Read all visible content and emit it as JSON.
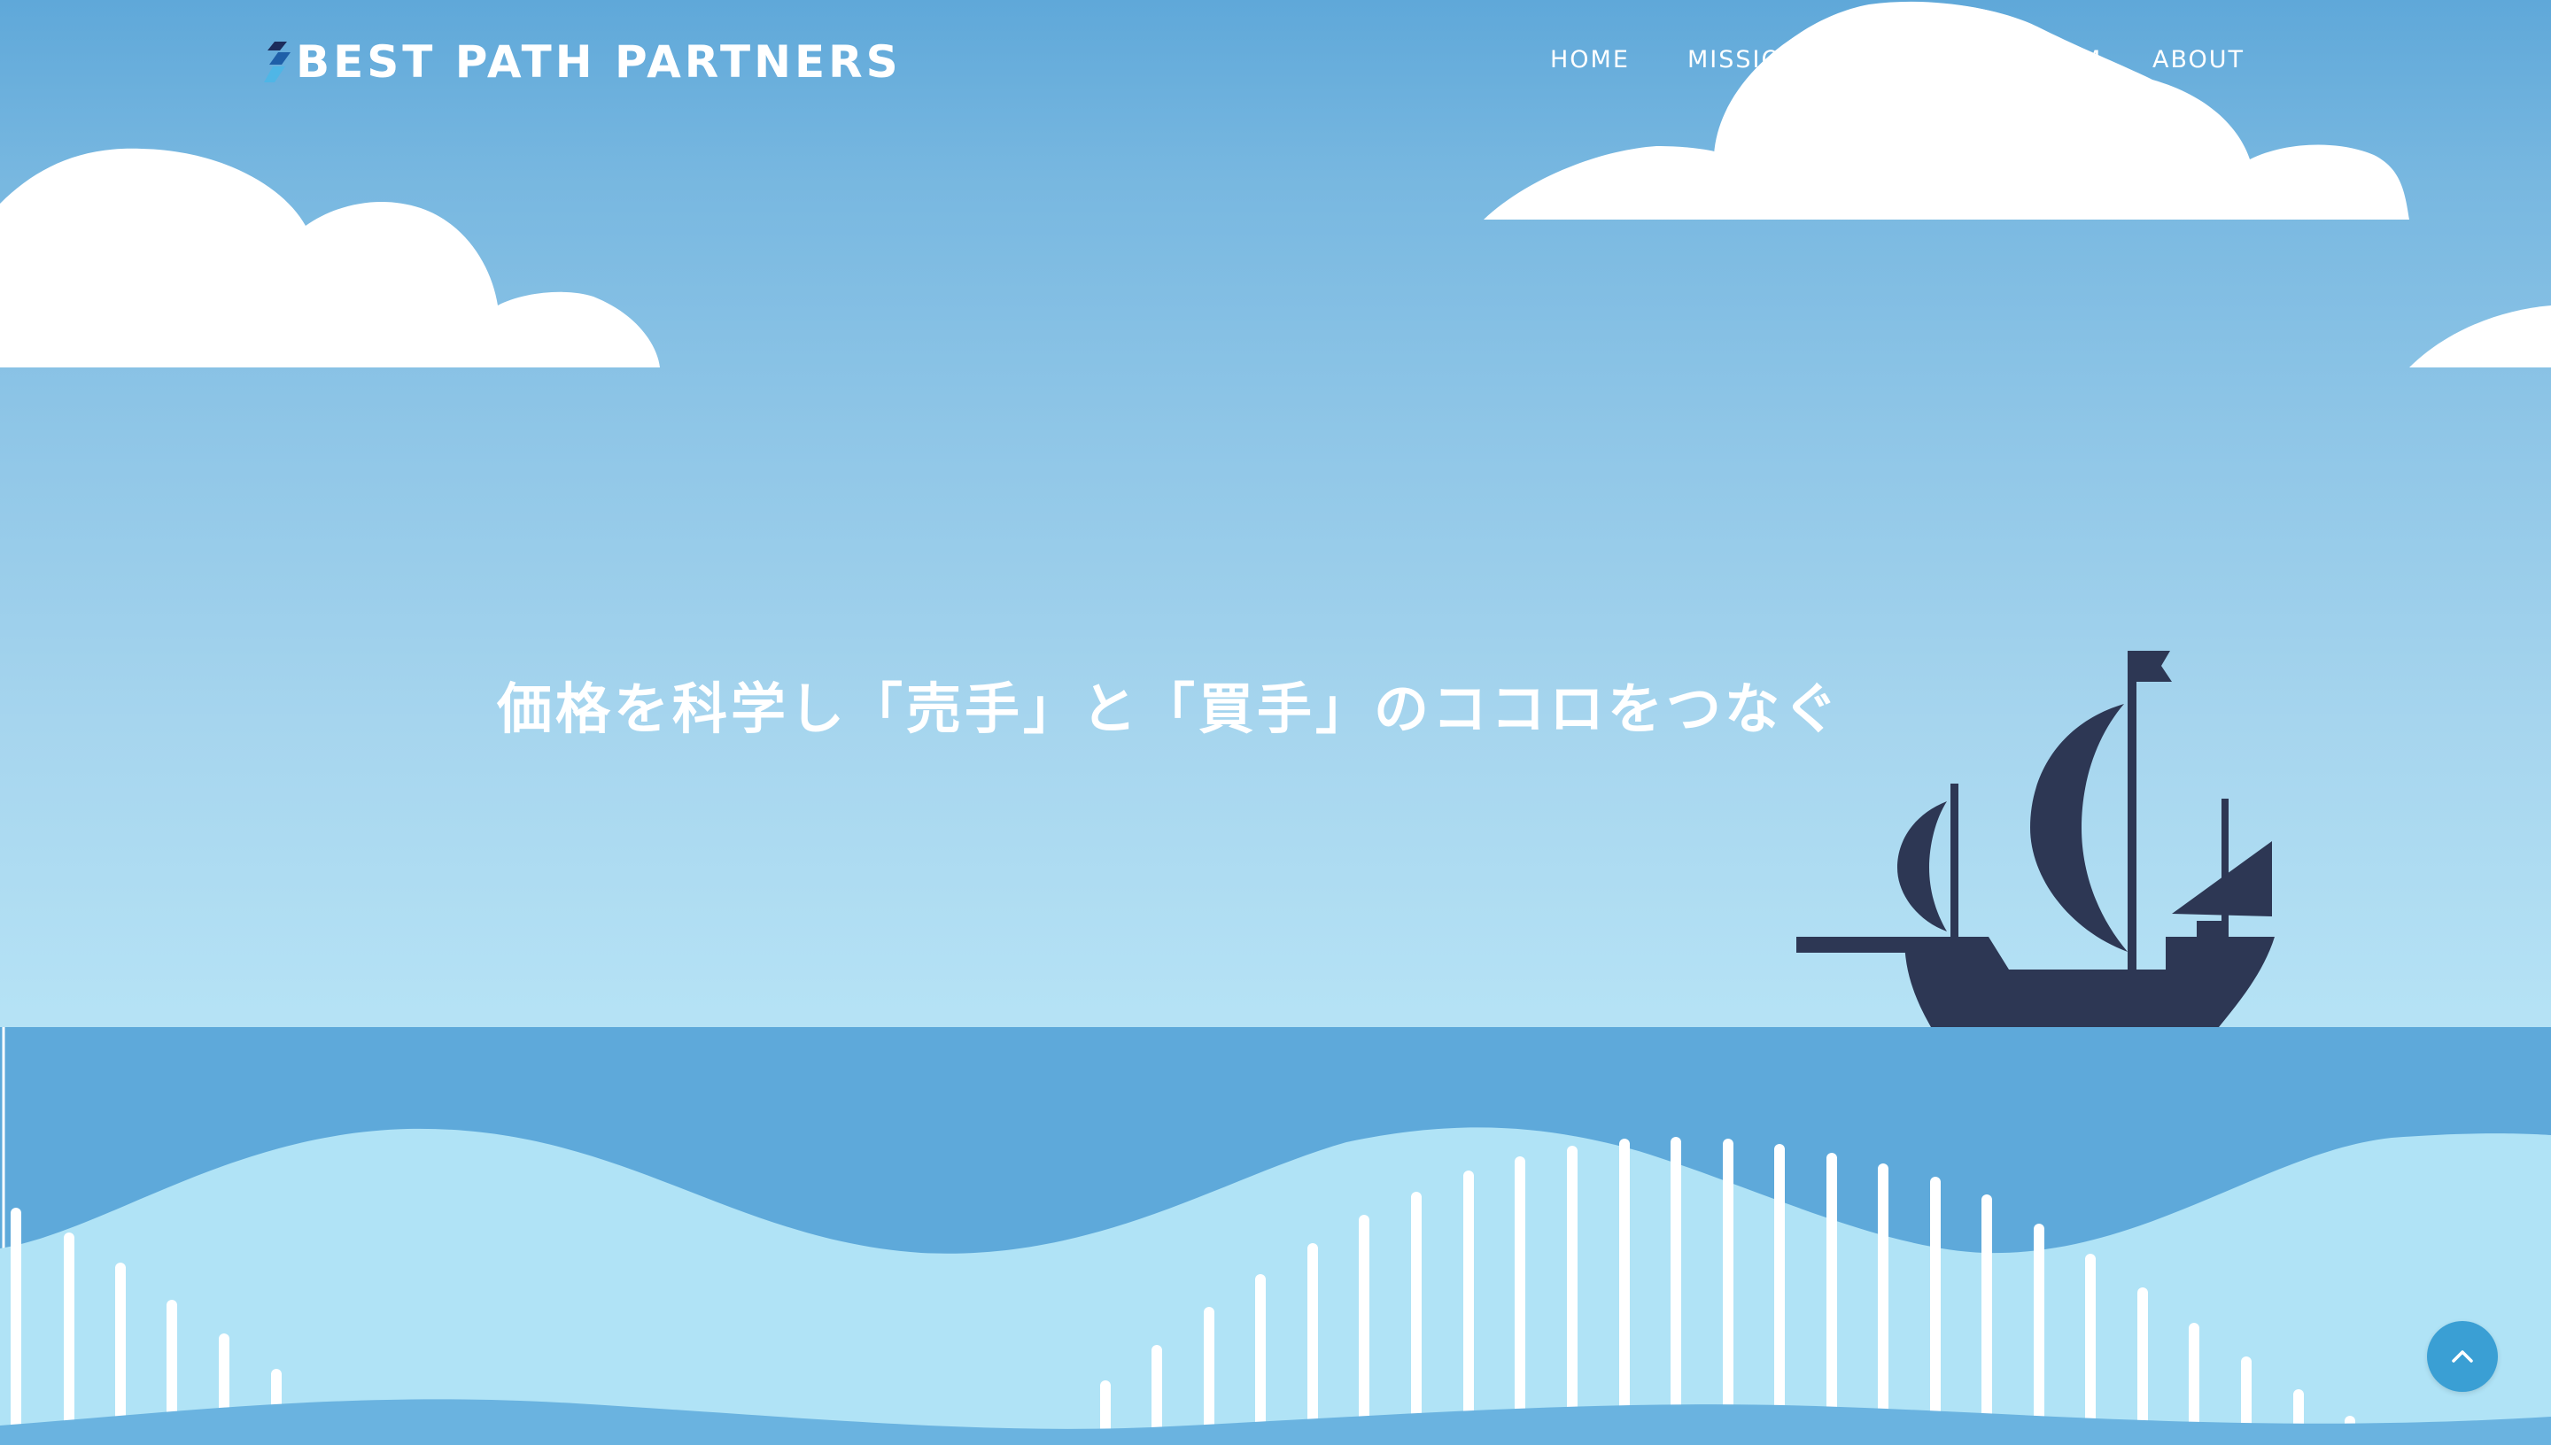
{
  "brand": {
    "name": "BEST PATH PARTNERS"
  },
  "nav": {
    "items": [
      {
        "label": "HOME"
      },
      {
        "label": "MISSION"
      },
      {
        "label": "TEAM"
      },
      {
        "label": "ABOUT"
      }
    ]
  },
  "hero": {
    "tagline": "価格を科学し「売手」と「買手」のココロをつなぐ"
  },
  "icons": {
    "scroll_top": "chevron-up-icon",
    "logo_mark": "stripes-logo-icon"
  },
  "colors": {
    "sky_top": "#5fa8d9",
    "sky_bottom": "#b8e6f7",
    "sea": "#5ea9da",
    "sea_light": "#b0e3f6",
    "ship": "#2d3754",
    "cloud": "#ffffff",
    "scroll_button": "#3a9fd4"
  }
}
